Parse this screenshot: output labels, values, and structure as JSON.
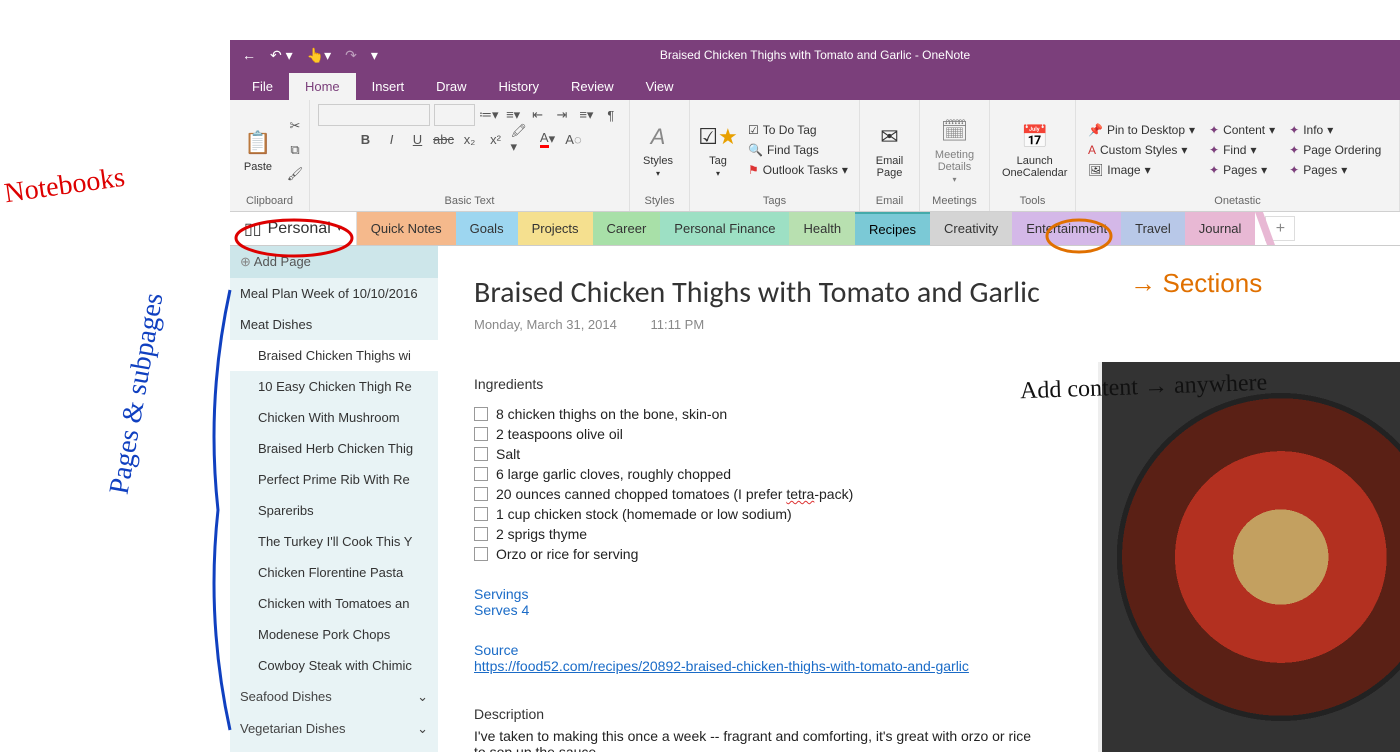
{
  "window": {
    "title": "Braised Chicken Thighs with Tomato and Garlic  -  OneNote"
  },
  "ribbonTabs": [
    "File",
    "Home",
    "Insert",
    "Draw",
    "History",
    "Review",
    "View"
  ],
  "ribbonActive": "Home",
  "groups": {
    "clipboard": {
      "label": "Clipboard",
      "paste": "Paste"
    },
    "basicText": {
      "label": "Basic Text"
    },
    "styles": {
      "label": "Styles",
      "btn": "Styles"
    },
    "tags": {
      "label": "Tags",
      "tag": "Tag",
      "todo": "To Do Tag",
      "find": "Find Tags",
      "outlook": "Outlook Tasks"
    },
    "email": {
      "label": "Email",
      "btn": "Email Page"
    },
    "meetings": {
      "label": "Meetings",
      "btn": "Meeting Details"
    },
    "tools": {
      "label": "Tools",
      "btn": "Launch OneCalendar"
    },
    "onetastic": {
      "label": "Onetastic",
      "pin": "Pin to Desktop",
      "custom": "Custom Styles",
      "image": "Image",
      "content": "Content",
      "find": "Find",
      "pages": "Pages",
      "info": "Info",
      "ordering": "Page Ordering",
      "pages2": "Pages"
    }
  },
  "notebook": "Personal",
  "sections": [
    {
      "label": "Quick Notes",
      "cls": "quick"
    },
    {
      "label": "Goals",
      "cls": "goals"
    },
    {
      "label": "Projects",
      "cls": "projects"
    },
    {
      "label": "Career",
      "cls": "career"
    },
    {
      "label": "Personal Finance",
      "cls": "pf"
    },
    {
      "label": "Health",
      "cls": "health"
    },
    {
      "label": "Recipes",
      "cls": "recipes",
      "active": true
    },
    {
      "label": "Creativity",
      "cls": "creativity"
    },
    {
      "label": "Entertainment",
      "cls": "ent"
    },
    {
      "label": "Travel",
      "cls": "travel"
    },
    {
      "label": "Journal",
      "cls": "journal"
    }
  ],
  "addPage": "Add Page",
  "pages": [
    {
      "label": "Meal Plan Week of 10/10/2016"
    },
    {
      "label": "Meat Dishes"
    },
    {
      "label": "Braised Chicken Thighs wi",
      "sub": true,
      "selected": true
    },
    {
      "label": "10 Easy Chicken Thigh Re",
      "sub": true
    },
    {
      "label": "Chicken With Mushroom",
      "sub": true
    },
    {
      "label": "Braised Herb Chicken Thig",
      "sub": true
    },
    {
      "label": "Perfect Prime Rib With Re",
      "sub": true
    },
    {
      "label": "Spareribs",
      "sub": true
    },
    {
      "label": "The Turkey I'll Cook This Y",
      "sub": true
    },
    {
      "label": "Chicken Florentine Pasta",
      "sub": true
    },
    {
      "label": "Chicken with Tomatoes an",
      "sub": true
    },
    {
      "label": "Modenese Pork Chops",
      "sub": true
    },
    {
      "label": "Cowboy Steak with Chimic",
      "sub": true
    }
  ],
  "pageGroups": [
    "Seafood Dishes",
    "Vegetarian Dishes"
  ],
  "note": {
    "title": "Braised Chicken Thighs with Tomato and Garlic",
    "date": "Monday, March 31, 2014",
    "time": "11:11 PM",
    "ingredientsHead": "Ingredients",
    "ingredients": [
      "8 chicken thighs on the bone, skin-on",
      "2 teaspoons olive oil",
      "Salt",
      "6 large garlic cloves, roughly chopped",
      "20 ounces canned chopped tomatoes (I prefer tetra-pack)",
      "1 cup chicken stock (homemade or low sodium)",
      "2 sprigs thyme",
      "Orzo or rice for serving"
    ],
    "servingsHead": "Servings",
    "servings": "Serves 4",
    "sourceHead": "Source",
    "sourceUrl": "https://food52.com/recipes/20892-braised-chicken-thighs-with-tomato-and-garlic",
    "descHead": "Description",
    "desc": "I've taken to making this once a week -- fragrant and comforting, it's great with orzo or rice to sop up the sauce."
  },
  "annotations": {
    "notebooks": "Notebooks",
    "pages": "Pages & subpages",
    "sections": "Sections",
    "content": "Add content → anywhere"
  }
}
